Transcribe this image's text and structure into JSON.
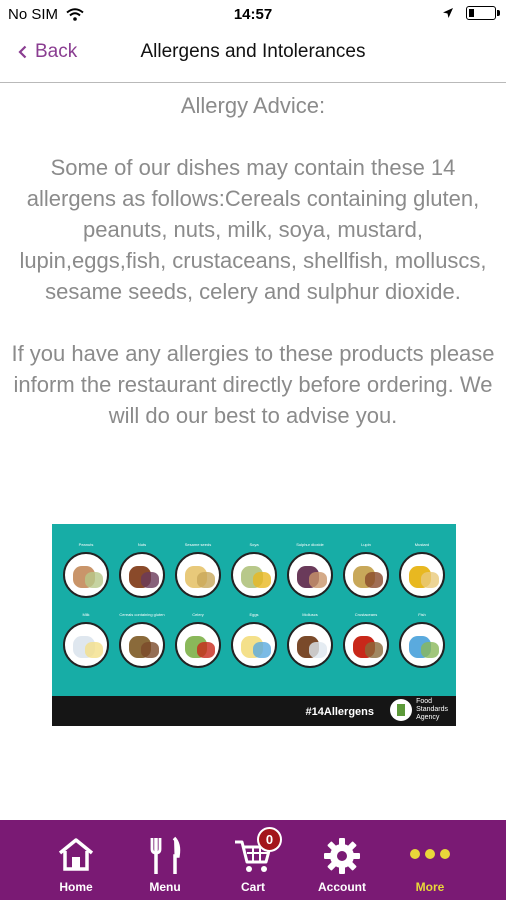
{
  "status_bar": {
    "carrier": "No SIM",
    "time": "14:57"
  },
  "nav": {
    "back_label": "Back",
    "title": "Allergens and Intolerances"
  },
  "content": {
    "heading": "Allergy Advice:",
    "paragraph1": "Some of our dishes may contain these 14 allergens as follows:Cereals containing gluten, peanuts, nuts, milk, soya, mustard, lupin,eggs,fish, crustaceans, shellfish, molluscs, sesame seeds, celery and sulphur dioxide.",
    "paragraph2": "If you have any allergies to these products please inform the restaurant directly before ordering. We will do our best to advise you."
  },
  "allergen_image": {
    "row1": [
      "Peanuts",
      "Nuts",
      "Sesame seeds",
      "Soya",
      "Sulphur dioxide",
      "Lupin",
      "Mustard"
    ],
    "row2": [
      "Milk",
      "Cereals containing gluten",
      "Celery",
      "Eggs",
      "Molluscs",
      "Crustaceans",
      "Fish"
    ],
    "hashtag": "#14Allergens",
    "agency_line1": "Food",
    "agency_line2": "Standards",
    "agency_line3": "Agency",
    "colors": {
      "background": "#17ada6",
      "footer": "#151515"
    }
  },
  "tab_bar": {
    "tabs": [
      {
        "label": "Home",
        "icon": "home-icon"
      },
      {
        "label": "Menu",
        "icon": "fork-knife-icon"
      },
      {
        "label": "Cart",
        "icon": "cart-icon"
      },
      {
        "label": "Account",
        "icon": "gear-icon"
      },
      {
        "label": "More",
        "icon": "more-dots-icon"
      }
    ],
    "cart_count": "0",
    "active_tab": "More",
    "colors": {
      "background": "#7a1a74",
      "active": "#e8d83a",
      "inactive": "#ffffff"
    }
  }
}
